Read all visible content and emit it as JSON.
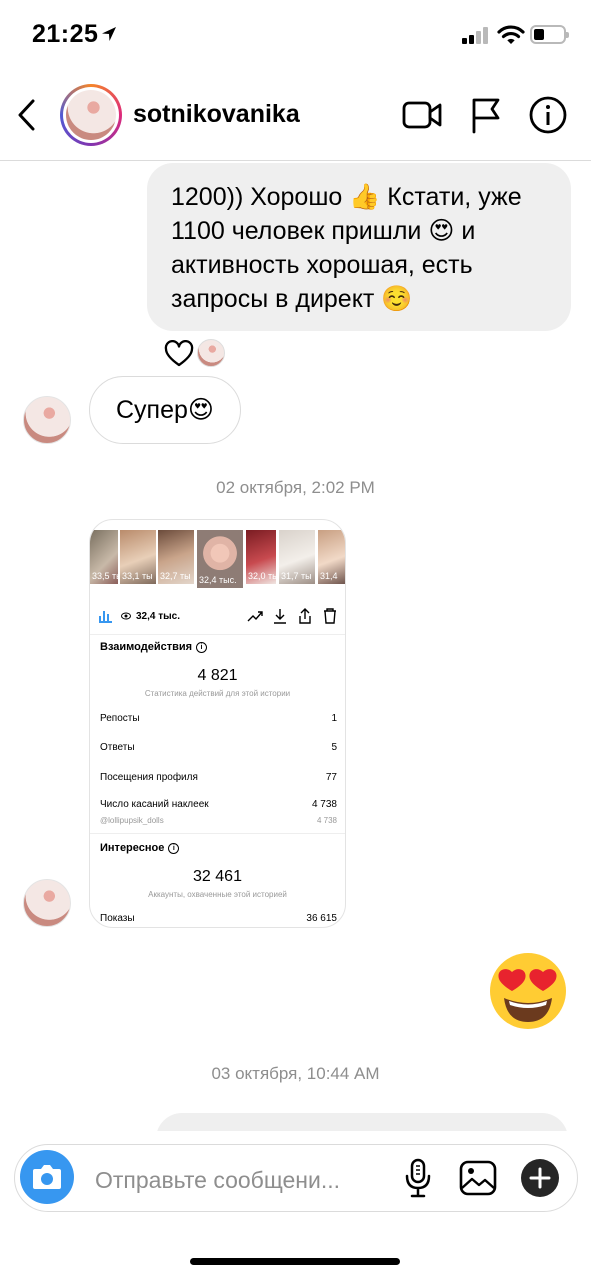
{
  "status_bar": {
    "time": "21:25"
  },
  "header": {
    "username": "sotnikovanika"
  },
  "messages": {
    "outgoing_1": "1200)) Хорошо 👍 Кстати, уже 1100 человек пришли 😍 и активность хорошая, есть запросы в директ ☺️",
    "incoming_1": "Супер😍",
    "timestamp_1": "02 октября, 2:02 PM",
    "outgoing_emoji": "😍",
    "timestamp_2": "03 октября, 10:44 AM"
  },
  "shared_screenshot": {
    "thumb_views": [
      "33,5 ты",
      "33,1 ты",
      "32,7 ты",
      "32,4 тыс.",
      "32,0 ты",
      "31,7 ты",
      "31,4"
    ],
    "views_count": "32,4 тыс.",
    "interactions_title": "Взаимодействия",
    "interactions_total": "4 821",
    "interactions_sub": "Статистика действий для этой истории",
    "rows": [
      {
        "label": "Репосты",
        "value": "1"
      },
      {
        "label": "Ответы",
        "value": "5"
      },
      {
        "label": "Посещения профиля",
        "value": "77"
      },
      {
        "label": "Число касаний наклеек",
        "value": "4 738"
      }
    ],
    "sticker_account": "@lollipupsik_dolls",
    "sticker_account_value": "4 738",
    "discovery_title": "Интересное",
    "discovery_total": "32 461",
    "discovery_sub": "Аккаунты, охваченные этой историей",
    "impressions_label": "Показы",
    "impressions_value": "36 615"
  },
  "composer": {
    "placeholder": "Отправьте сообщени..."
  },
  "colors": {
    "accent_blue": "#3797f0",
    "bubble_gray": "#efefef",
    "timestamp_gray": "#8e8e8e"
  }
}
